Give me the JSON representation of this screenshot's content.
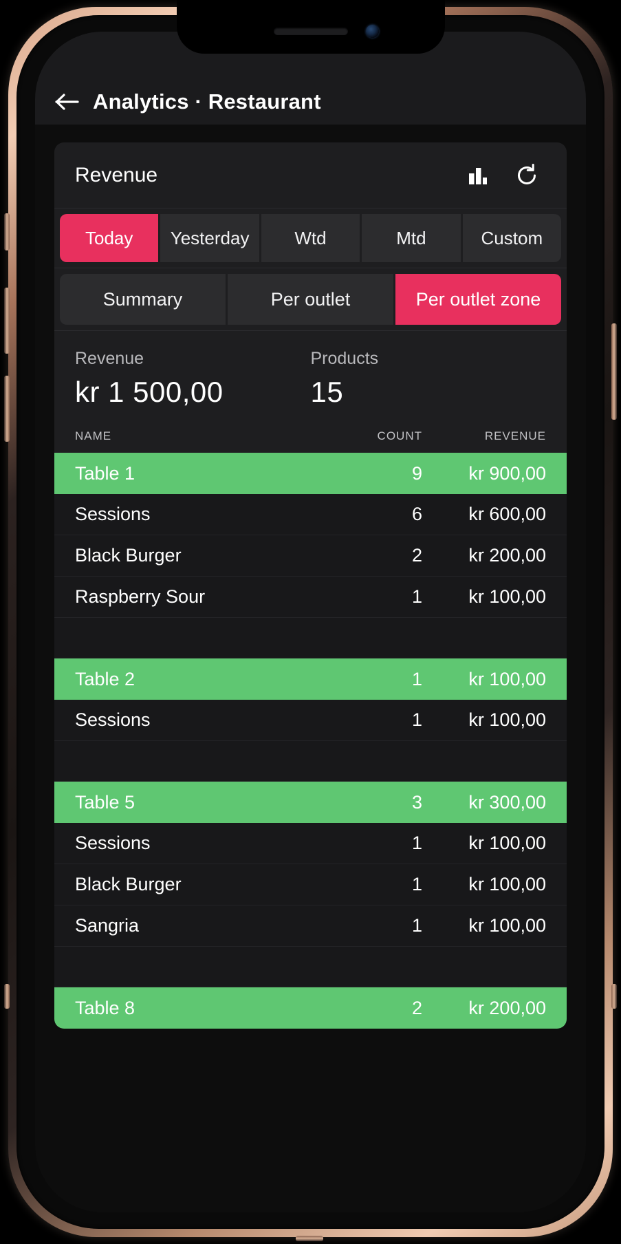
{
  "appbar": {
    "back_icon": "arrow-left-icon",
    "title": "Analytics · Restaurant"
  },
  "card": {
    "title": "Revenue",
    "chart_icon": "bar-chart-icon",
    "refresh_icon": "refresh-icon"
  },
  "period_tabs": [
    {
      "label": "Today",
      "active": true
    },
    {
      "label": "Yesterday",
      "active": false
    },
    {
      "label": "Wtd",
      "active": false
    },
    {
      "label": "Mtd",
      "active": false
    },
    {
      "label": "Custom",
      "active": false
    }
  ],
  "scope_tabs": [
    {
      "label": "Summary",
      "active": false
    },
    {
      "label": "Per outlet",
      "active": false
    },
    {
      "label": "Per outlet zone",
      "active": true
    }
  ],
  "kpis": [
    {
      "label": "Revenue",
      "value": "kr 1 500,00"
    },
    {
      "label": "Products",
      "value": "15"
    }
  ],
  "table": {
    "columns": {
      "name": "NAME",
      "count": "COUNT",
      "revenue": "REVENUE"
    },
    "rows": [
      {
        "name": "Table 1",
        "count": "9",
        "revenue": "kr 900,00",
        "type": "group"
      },
      {
        "name": "Sessions",
        "count": "6",
        "revenue": "kr 600,00",
        "type": "item"
      },
      {
        "name": "Black Burger",
        "count": "2",
        "revenue": "kr 200,00",
        "type": "item"
      },
      {
        "name": "Raspberry Sour",
        "count": "1",
        "revenue": "kr 100,00",
        "type": "item"
      },
      {
        "name": "",
        "count": "",
        "revenue": "",
        "type": "spacer"
      },
      {
        "name": "Table 2",
        "count": "1",
        "revenue": "kr 100,00",
        "type": "group"
      },
      {
        "name": "Sessions",
        "count": "1",
        "revenue": "kr 100,00",
        "type": "item"
      },
      {
        "name": "",
        "count": "",
        "revenue": "",
        "type": "spacer"
      },
      {
        "name": "Table 5",
        "count": "3",
        "revenue": "kr 300,00",
        "type": "group"
      },
      {
        "name": "Sessions",
        "count": "1",
        "revenue": "kr 100,00",
        "type": "item"
      },
      {
        "name": "Black Burger",
        "count": "1",
        "revenue": "kr 100,00",
        "type": "item"
      },
      {
        "name": "Sangria",
        "count": "1",
        "revenue": "kr 100,00",
        "type": "item"
      },
      {
        "name": "",
        "count": "",
        "revenue": "",
        "type": "spacer"
      },
      {
        "name": "Table 8",
        "count": "2",
        "revenue": "kr 200,00",
        "type": "group"
      }
    ]
  },
  "colors": {
    "accent": "#e8305e",
    "group_green": "#5fc772",
    "card_bg": "#1e1e20",
    "row_bg": "#18181a",
    "screen_bg": "#0d0d0d",
    "appbar_bg": "#1b1b1d"
  }
}
